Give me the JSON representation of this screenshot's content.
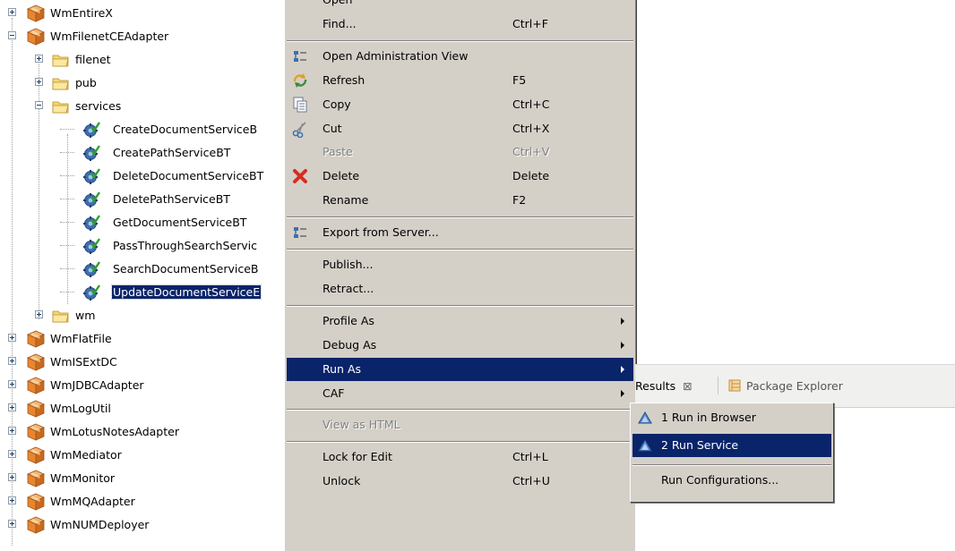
{
  "tree": {
    "items": [
      {
        "label": "WmEntireX",
        "type": "package",
        "level": 0,
        "expander": "plus"
      },
      {
        "label": "WmFilenetCEAdapter",
        "type": "package",
        "level": 0,
        "expander": "minus"
      },
      {
        "label": "filenet",
        "type": "folder",
        "level": 1,
        "expander": "plus"
      },
      {
        "label": "pub",
        "type": "folder",
        "level": 1,
        "expander": "plus"
      },
      {
        "label": "services",
        "type": "folder",
        "level": 1,
        "expander": "minus"
      },
      {
        "label": "CreateDocumentServiceB",
        "type": "service",
        "level": 2
      },
      {
        "label": "CreatePathServiceBT",
        "type": "service",
        "level": 2
      },
      {
        "label": "DeleteDocumentServiceBT",
        "type": "service",
        "level": 2
      },
      {
        "label": "DeletePathServiceBT",
        "type": "service",
        "level": 2
      },
      {
        "label": "GetDocumentServiceBT",
        "type": "service",
        "level": 2
      },
      {
        "label": "PassThroughSearchServic",
        "type": "service",
        "level": 2
      },
      {
        "label": "SearchDocumentServiceB",
        "type": "service",
        "level": 2
      },
      {
        "label": "UpdateDocumentServiceE",
        "type": "service",
        "level": 2,
        "selected": true
      },
      {
        "label": "wm",
        "type": "folder",
        "level": 1,
        "expander": "plus"
      },
      {
        "label": "WmFlatFile",
        "type": "package",
        "level": 0,
        "expander": "plus"
      },
      {
        "label": "WmISExtDC",
        "type": "package",
        "level": 0,
        "expander": "plus"
      },
      {
        "label": "WmJDBCAdapter",
        "type": "package",
        "level": 0,
        "expander": "plus"
      },
      {
        "label": "WmLogUtil",
        "type": "package",
        "level": 0,
        "expander": "plus"
      },
      {
        "label": "WmLotusNotesAdapter",
        "type": "package",
        "level": 0,
        "expander": "plus"
      },
      {
        "label": "WmMediator",
        "type": "package",
        "level": 0,
        "expander": "plus"
      },
      {
        "label": "WmMonitor",
        "type": "package",
        "level": 0,
        "expander": "plus"
      },
      {
        "label": "WmMQAdapter",
        "type": "package",
        "level": 0,
        "expander": "plus"
      },
      {
        "label": "WmNUMDeployer",
        "type": "package",
        "level": 0,
        "expander": "plus"
      }
    ]
  },
  "context_menu": {
    "items": [
      {
        "kind": "item",
        "label": "Open",
        "shortcut": "",
        "partial": true
      },
      {
        "kind": "item",
        "label": "Find...",
        "shortcut": "Ctrl+F"
      },
      {
        "kind": "sep"
      },
      {
        "kind": "item",
        "label": "Open Administration View",
        "shortcut": "",
        "icon": "admin-view-icon"
      },
      {
        "kind": "item",
        "label": "Refresh",
        "shortcut": "F5",
        "icon": "refresh-icon"
      },
      {
        "kind": "item",
        "label": "Copy",
        "shortcut": "Ctrl+C",
        "icon": "copy-icon"
      },
      {
        "kind": "item",
        "label": "Cut",
        "shortcut": "Ctrl+X",
        "icon": "cut-icon"
      },
      {
        "kind": "item",
        "label": "Paste",
        "shortcut": "Ctrl+V",
        "disabled": true
      },
      {
        "kind": "item",
        "label": "Delete",
        "shortcut": "Delete",
        "icon": "delete-icon"
      },
      {
        "kind": "item",
        "label": "Rename",
        "shortcut": "F2"
      },
      {
        "kind": "sep"
      },
      {
        "kind": "item",
        "label": "Export from Server...",
        "shortcut": "",
        "icon": "export-icon"
      },
      {
        "kind": "sep"
      },
      {
        "kind": "item",
        "label": "Publish...",
        "shortcut": ""
      },
      {
        "kind": "item",
        "label": "Retract...",
        "shortcut": ""
      },
      {
        "kind": "sep"
      },
      {
        "kind": "item",
        "label": "Profile As",
        "shortcut": "",
        "submenu": true
      },
      {
        "kind": "item",
        "label": "Debug As",
        "shortcut": "",
        "submenu": true
      },
      {
        "kind": "item",
        "label": "Run As",
        "shortcut": "",
        "submenu": true,
        "highlighted": true
      },
      {
        "kind": "item",
        "label": "CAF",
        "shortcut": "",
        "submenu": true
      },
      {
        "kind": "sep"
      },
      {
        "kind": "item",
        "label": "View as HTML",
        "shortcut": "",
        "disabled": true
      },
      {
        "kind": "sep"
      },
      {
        "kind": "item",
        "label": "Lock for Edit",
        "shortcut": "Ctrl+L"
      },
      {
        "kind": "item",
        "label": "Unlock",
        "shortcut": "Ctrl+U"
      }
    ]
  },
  "background_view": {
    "tabs": [
      {
        "label": "Results",
        "close": "⊠"
      },
      {
        "label": "Package Explorer"
      }
    ]
  },
  "submenu": {
    "items": [
      {
        "kind": "item",
        "label": "1 Run in Browser",
        "icon": "run-triangle-icon"
      },
      {
        "kind": "item",
        "label": "2 Run Service",
        "icon": "run-triangle-icon",
        "highlighted": true
      },
      {
        "kind": "sep"
      },
      {
        "kind": "item",
        "label": "Run Configurations..."
      }
    ]
  },
  "colors": {
    "highlight": "#0a246a",
    "menu_bg": "#d4d0c8",
    "package_orange": "#e8862f",
    "folder_yellow": "#f5d76e",
    "service_blue": "#3d6fae",
    "check_green": "#2fa02f"
  }
}
